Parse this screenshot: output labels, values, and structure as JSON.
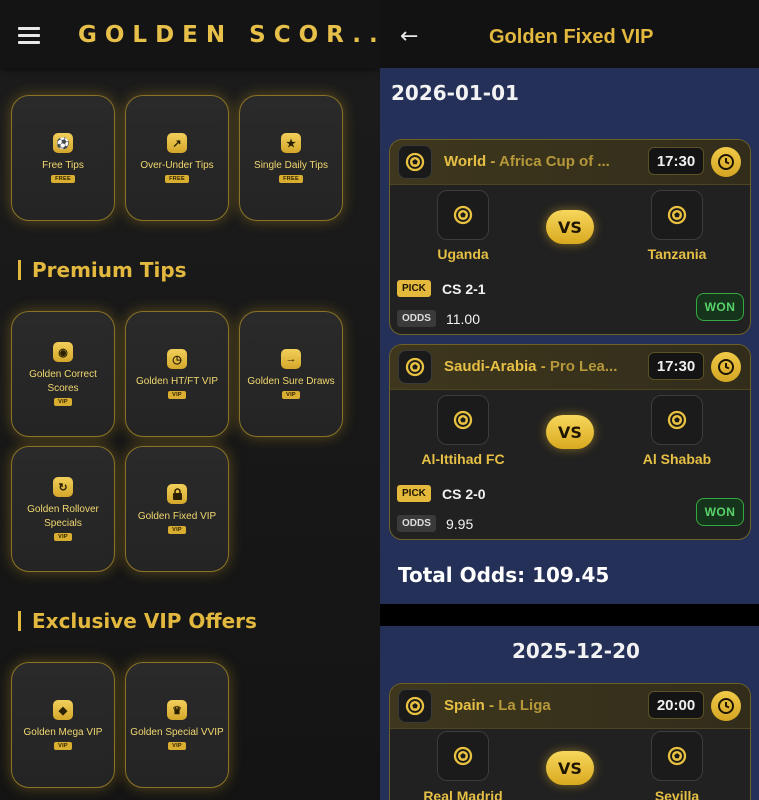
{
  "left": {
    "app_title": "GOLDEN SCOR...",
    "free_tiles": [
      {
        "label": "Free Tips",
        "badge": "FREE",
        "icon": "soccer-ball-icon"
      },
      {
        "label": "Over-Under Tips",
        "badge": "FREE",
        "icon": "trend-up-icon"
      },
      {
        "label": "Single Daily Tips",
        "badge": "FREE",
        "icon": "star-icon"
      }
    ],
    "premium_title": "Premium Tips",
    "premium_tiles": [
      {
        "label": "Golden Correct Scores",
        "badge": "VIP",
        "icon": "target-icon"
      },
      {
        "label": "Golden HT/FT VIP",
        "badge": "VIP",
        "icon": "clock-icon"
      },
      {
        "label": "Golden Sure Draws",
        "badge": "VIP",
        "icon": "arrow-right-icon"
      },
      {
        "label": "Golden Rollover Specials",
        "badge": "VIP",
        "icon": "refresh-icon"
      },
      {
        "label": "Golden Fixed VIP",
        "badge": "VIP",
        "icon": "lock-icon"
      }
    ],
    "exclusive_title": "Exclusive VIP Offers",
    "exclusive_tiles": [
      {
        "label": "Golden Mega VIP",
        "badge": "VIP",
        "icon": "diamond-icon"
      },
      {
        "label": "Golden Special VVIP",
        "badge": "VIP",
        "icon": "crown-icon"
      }
    ]
  },
  "right": {
    "screen_title": "Golden Fixed VIP",
    "days": [
      {
        "date": "2026-01-01",
        "total_label": "Total Odds: 109.45",
        "matches": [
          {
            "country": "World",
            "competition": "Africa Cup of ...",
            "time": "17:30",
            "home": "Uganda",
            "away": "Tanzania",
            "vs": "VS",
            "pick_label": "PICK",
            "pick": "CS 2-1",
            "odds_label": "ODDS",
            "odds": "11.00",
            "result": "WON"
          },
          {
            "country": "Saudi-Arabia",
            "competition": "Pro Lea...",
            "time": "17:30",
            "home": "Al-Ittihad FC",
            "away": "Al Shabab",
            "vs": "VS",
            "pick_label": "PICK",
            "pick": "CS 2-0",
            "odds_label": "ODDS",
            "odds": "9.95",
            "result": "WON"
          }
        ]
      },
      {
        "date": "2025-12-20",
        "matches": [
          {
            "country": "Spain",
            "competition": "La Liga",
            "time": "20:00",
            "home": "Real Madrid",
            "away": "Sevilla",
            "vs": "VS"
          }
        ]
      }
    ],
    "separator": "-"
  }
}
